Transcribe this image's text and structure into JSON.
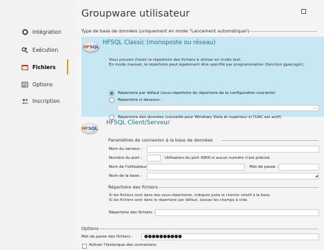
{
  "sidebar": {
    "items": [
      {
        "label": "Intégration",
        "icon": "circle-outline-icon"
      },
      {
        "label": "Exécution",
        "icon": "gear-run-icon"
      },
      {
        "label": "Fichiers",
        "icon": "folder-icon"
      },
      {
        "label": "Options",
        "icon": "options-icon"
      },
      {
        "label": "Inscription",
        "icon": "people-icon"
      }
    ],
    "active_index": 2
  },
  "header": {
    "title": "Groupware utilisateur"
  },
  "db_type": {
    "label": "Type de base de données (uniquement en mode \"Lancement automatique\")"
  },
  "classic": {
    "logo_h": "HF",
    "logo_s": "SQL",
    "title": "HFSQL Classic (monoposte ou réseau)",
    "desc_line1": "Vous pouvez choisir le répertoire des fichiers à utiliser en mode test.",
    "desc_line2": "En mode manuel, le répertoire peut également être spécifié par programmation (fonction gpwLogin).",
    "option_default": "Répertoire par défaut (sous-répertoire du répertoire de la configuration courante)",
    "option_custom": "Répertoire ci-dessous :",
    "path_value": "",
    "browse_label": "...",
    "option_data": "Répertoire des données (conseillé pour Windows Vista et supérieur si l'UAC est actif)"
  },
  "client_server": {
    "title": "HFSQL Client/Serveur",
    "conn_header": "Paramètres de connexion à la base de données",
    "server_label": "Nom du serveur :",
    "server_value": "",
    "port_label": "Numéro du port :",
    "port_value": "",
    "port_hint": "Utilisation du port 4900 si aucun numéro n'est précisé.",
    "user_label": "Nom de l'utilisateur :",
    "user_value": "",
    "password_label": "Mot de passe :",
    "password_value": "",
    "db_label": "Nom de la base :",
    "db_value": "",
    "files_header": "Répertoire des fichiers",
    "files_help1": "Si les fichiers sont dans des sous-répertoires, indiquez juste le chemin relatif à la base.",
    "files_help2": "Si les fichiers sont dans le répertoire par défaut, laissez les champs à vide.",
    "files_label": "Répertoire des fichiers :",
    "files_value": ""
  },
  "options": {
    "header": "Options",
    "files_password_label": "Mot de passe des fichiers :",
    "files_password_value": "●●●●●●●●●●",
    "history_label": "Activer l'historique des connexions"
  }
}
